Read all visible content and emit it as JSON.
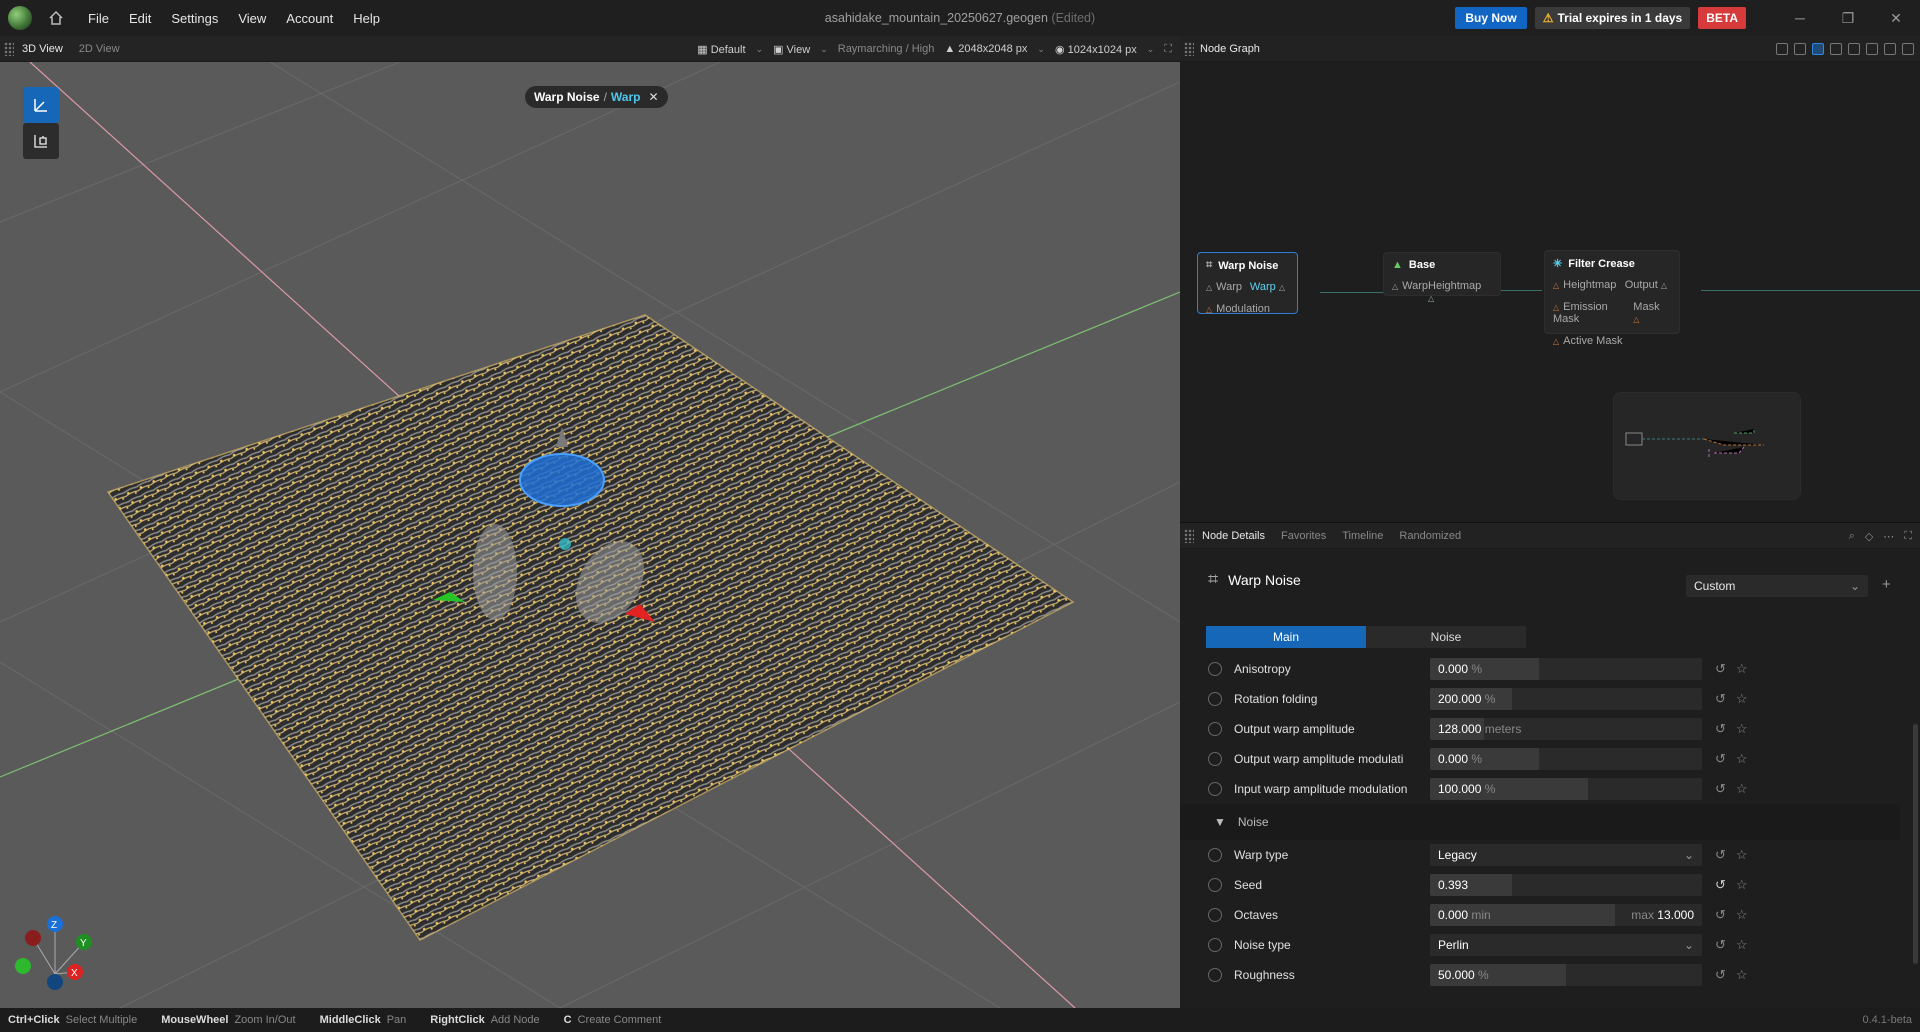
{
  "menu": [
    "File",
    "Edit",
    "Settings",
    "View",
    "Account",
    "Help"
  ],
  "window": {
    "title": "asahidake_mountain_20250627.geogen",
    "edited": "(Edited)"
  },
  "actions": {
    "buy_now": "Buy Now",
    "trial": "Trial expires in 1 days",
    "beta": "BETA"
  },
  "viewport": {
    "tabs": [
      "3D View",
      "2D View"
    ],
    "default_label": "Default",
    "view_label": "View",
    "render_mode": "Raymarching / High",
    "resolution": "2048x2048 px",
    "preview_resolution": "1024x1024 px",
    "breadcrumb_node": "Warp Noise",
    "breadcrumb_sep": "/",
    "breadcrumb_output": "Warp"
  },
  "node_graph": {
    "title": "Node Graph",
    "nodes": [
      {
        "title": "Warp Noise",
        "inputs": [
          "Warp",
          "Modulation"
        ],
        "outputs": [
          "Warp"
        ]
      },
      {
        "title": "Base",
        "inputs": [
          "Warp"
        ],
        "outputs": [
          "Heightmap"
        ]
      },
      {
        "title": "Filter Crease",
        "inputs": [
          "Heightmap",
          "Emission Mask",
          "Active Mask"
        ],
        "outputs": [
          "Output",
          "Mask"
        ]
      }
    ]
  },
  "details": {
    "tabs": [
      "Node Details",
      "Favorites",
      "Timeline",
      "Randomized"
    ],
    "node_name": "Warp Noise",
    "preset": "Custom",
    "subtabs": [
      "Main",
      "Noise"
    ],
    "params": [
      {
        "label": "Anisotropy",
        "value": "0.000",
        "unit": "%",
        "fill": 0.4
      },
      {
        "label": "Rotation folding",
        "value": "200.000",
        "unit": "%",
        "fill": 0.3
      },
      {
        "label": "Output warp amplitude",
        "value": "128.000",
        "unit": "meters",
        "fill": 0.2
      },
      {
        "label": "Output warp amplitude modulati",
        "value": "0.000",
        "unit": "%",
        "fill": 0.4
      },
      {
        "label": "Input warp amplitude modulation",
        "value": "100.000",
        "unit": "%",
        "fill": 0.58
      }
    ],
    "section": "Noise",
    "noise_params": {
      "warp_type": {
        "label": "Warp type",
        "value": "Legacy"
      },
      "seed": {
        "label": "Seed",
        "value": "0.393",
        "fill": 0.3
      },
      "octaves": {
        "label": "Octaves",
        "min_value": "0.000",
        "min_label": "min",
        "max_label": "max",
        "max_value": "13.000"
      },
      "noise_type": {
        "label": "Noise type",
        "value": "Perlin"
      },
      "roughness": {
        "label": "Roughness",
        "value": "50.000",
        "unit": "%",
        "fill": 0.5
      }
    }
  },
  "status": {
    "hints": [
      {
        "key": "Ctrl+Click",
        "desc": "Select Multiple"
      },
      {
        "key": "MouseWheel",
        "desc": "Zoom In/Out"
      },
      {
        "key": "MiddleClick",
        "desc": "Pan"
      },
      {
        "key": "RightClick",
        "desc": "Add Node"
      },
      {
        "key": "C",
        "desc": "Create Comment"
      }
    ],
    "version": "0.4.1-beta"
  },
  "colors": {
    "accent": "#1667b8",
    "beta": "#d63a3a",
    "terrain_highlight": "#f1c45a"
  }
}
